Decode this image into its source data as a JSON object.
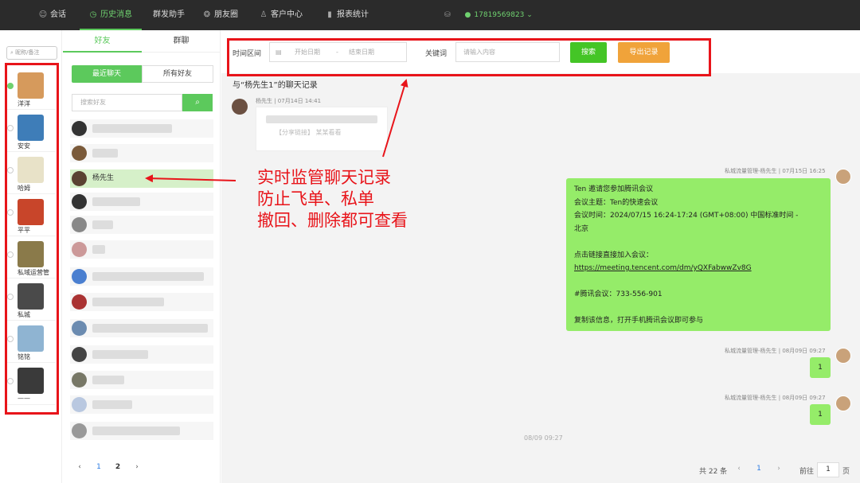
{
  "nav": {
    "items": [
      {
        "label": "会话",
        "icon": "chat-bubble-icon",
        "active": false
      },
      {
        "label": "历史消息",
        "icon": "clock-icon",
        "active": true
      },
      {
        "label": "群发助手",
        "icon": "",
        "active": false
      },
      {
        "label": "朋友圈",
        "icon": "aperture-icon",
        "active": false
      },
      {
        "label": "客户中心",
        "icon": "person-icon",
        "active": false
      },
      {
        "label": "报表统计",
        "icon": "bar-chart-icon",
        "active": false
      }
    ],
    "phone": "17819569823"
  },
  "accounts": {
    "search_placeholder": "昵称/备注",
    "items": [
      {
        "name": "洋洋",
        "online": true,
        "avatar_color": "#d69a5c"
      },
      {
        "name": "安安",
        "online": false,
        "avatar_color": "#3e7db8"
      },
      {
        "name": "哈姆",
        "online": false,
        "avatar_color": "#e8e2c8"
      },
      {
        "name": "平平",
        "online": false,
        "avatar_color": "#c8452a"
      },
      {
        "name": "私域运营管",
        "online": false,
        "avatar_color": "#8a7a4a"
      },
      {
        "name": "私城",
        "online": false,
        "avatar_color": "#4a4a4a"
      },
      {
        "name": "铭铭",
        "online": false,
        "avatar_color": "#8fb4d2"
      },
      {
        "name": "——",
        "online": false,
        "avatar_color": "#3a3a3a"
      }
    ]
  },
  "friends": {
    "tab_friends": "好友",
    "tab_groups": "群聊",
    "seg_recent": "最近聊天",
    "seg_all": "所有好友",
    "search_placeholder": "搜索好友",
    "selected_name": "杨先生",
    "pages": [
      "1",
      "2"
    ]
  },
  "filter": {
    "time_label": "时间区间",
    "start_placeholder": "开始日期",
    "dash": "-",
    "end_placeholder": "结束日期",
    "keyword_label": "关键词",
    "keyword_placeholder": "请输入内容",
    "search_btn": "搜索",
    "export_btn": "导出记录"
  },
  "chat": {
    "title": "与“杨先生1”的聊天记录",
    "incoming_meta": "杨先生 | 07月14日 14:41",
    "incoming_text": "【分享链接】 某某看看",
    "outgoing_meta_1": "私城流量管理-杨先生 | 07月15日 16:25",
    "meeting_lines": [
      "Ten 邀请您参加腾讯会议",
      "会议主题：Ten的快速会议",
      "会议时间：2024/07/15 16:24-17:24 (GMT+08:00) 中国标准时间 -",
      "北京",
      "",
      "点击链接直接加入会议：",
      "https://meeting.tencent.com/dm/yQXFabwwZv8G",
      "",
      "#腾讯会议：733-556-901",
      "",
      "复制该信息，打开手机腾讯会议即可参与"
    ],
    "outgoing_meta_2": "私城流量管理-杨先生 | 08月09日 09:27",
    "reply_2": "1",
    "outgoing_meta_3": "私城流量管理-杨先生 | 08月09日 09:27",
    "reply_3": "1",
    "timestamp": "08/09 09:27"
  },
  "pager": {
    "total": "共 22 条",
    "current": "1",
    "goto_label": "前往",
    "goto_value": "1",
    "page_suffix": "页"
  },
  "annotation": {
    "lines": [
      "实时监管聊天记录",
      "防止飞单、私单",
      "撤回、删除都可查看"
    ],
    "color": "#e8141a"
  }
}
